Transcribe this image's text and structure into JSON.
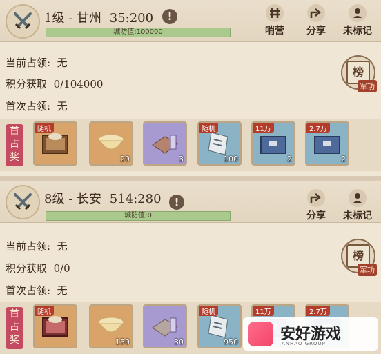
{
  "panels": [
    {
      "level": "1级",
      "dash": "-",
      "city": "甘州",
      "score": "35:200",
      "defense": "城防值:100000",
      "defense_pct": 1.0,
      "actions": [
        {
          "icon": "camp-icon",
          "label": "哨营"
        },
        {
          "icon": "share-icon",
          "label": "分享"
        },
        {
          "icon": "marker-icon",
          "label": "未标记"
        }
      ],
      "occupier_label": "当前占领:",
      "occupier_value": "无",
      "points_label": "积分获取",
      "points_value": "0/104000",
      "first_label": "首次占领:",
      "first_value": "无",
      "rank_label": "榜",
      "rank_tag": "军功",
      "first_award": "首占奖",
      "rewards": [
        {
          "quality": "orange",
          "corner": "随机",
          "count": "",
          "icon": "chest-icon"
        },
        {
          "quality": "orange",
          "corner": "",
          "count": "20",
          "icon": "ingot-icon"
        },
        {
          "quality": "purple",
          "corner": "",
          "count": "3",
          "icon": "cloth-icon"
        },
        {
          "quality": "blue",
          "corner": "随机",
          "count": "100",
          "icon": "scroll-icon"
        },
        {
          "quality": "blue",
          "corner": "11万",
          "count": "2",
          "icon": "box-icon"
        },
        {
          "quality": "blue",
          "corner": "2.7万",
          "count": "2",
          "icon": "box-icon"
        }
      ]
    },
    {
      "level": "8级",
      "dash": "-",
      "city": "长安",
      "score": "514:280",
      "defense": "城防值:0",
      "defense_pct": 1.0,
      "actions": [
        {
          "icon": "share-icon",
          "label": "分享"
        },
        {
          "icon": "marker-icon",
          "label": "未标记"
        }
      ],
      "occupier_label": "当前占领:",
      "occupier_value": "无",
      "points_label": "积分获取",
      "points_value": "0/0",
      "first_label": "首次占领:",
      "first_value": "无",
      "rank_label": "榜",
      "rank_tag": "军功",
      "first_award": "首占奖",
      "rewards": [
        {
          "quality": "orange",
          "corner": "随机",
          "count": "",
          "icon": "chest-icon"
        },
        {
          "quality": "orange",
          "corner": "",
          "count": "150",
          "icon": "ingot-icon"
        },
        {
          "quality": "purple",
          "corner": "",
          "count": "30",
          "icon": "cloth-icon"
        },
        {
          "quality": "blue",
          "corner": "随机",
          "count": "950",
          "icon": "scroll-icon"
        },
        {
          "quality": "blue",
          "corner": "11万",
          "count": "",
          "icon": "box-icon"
        },
        {
          "quality": "blue",
          "corner": "2.7万",
          "count": "",
          "icon": "box-icon"
        }
      ]
    }
  ],
  "watermark": {
    "text": "安好游戏",
    "sub": "ANHAO GROUP"
  }
}
